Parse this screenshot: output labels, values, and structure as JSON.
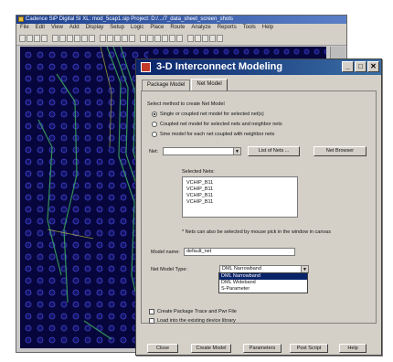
{
  "app_window": {
    "title": "Cadence SiP Digital SI XL: mod_5cap1.sip  Project: D:/.../7_data_sheet_screen_shots",
    "menu": [
      "File",
      "Edit",
      "View",
      "Add",
      "Display",
      "Setup",
      "Logic",
      "Place",
      "Route",
      "Analyze",
      "Reports",
      "Tools",
      "Help"
    ]
  },
  "dialog": {
    "title": "3-D Interconnect Modeling",
    "tabs": [
      "Package Model",
      "Net Model"
    ],
    "active_tab": "Net Model",
    "instructions": "Select method to create Net Model",
    "options": [
      {
        "label": "Single or coupled net model for selected net(s)",
        "selected": true
      },
      {
        "label": "Coupled net model for selected nets and neighbor nets",
        "selected": false
      },
      {
        "label": "Sme model for each net coupled with neighbor nets",
        "selected": false
      }
    ],
    "net_label": "Net:",
    "net_value": "",
    "list_of_nets_button": "List of Nets ...",
    "net_browser_button": "Net Browser",
    "selected_nets_label": "Selected Nets:",
    "selected_nets": [
      "VCHIP_B11",
      "VCHIP_B11",
      "VCHIP_B11",
      "VCHIP_B11"
    ],
    "note": "* Nets can also be selected by mouse pick in the window in canvas",
    "model_name_label": "Model name:",
    "model_name_value": "default_net",
    "net_model_type_label": "Net Model Type:",
    "net_model_type_value": "DML Narrowband",
    "net_model_type_options": [
      "DML Narrowband",
      "DML Wideband",
      "S-Parameter"
    ],
    "net_model_type_selected_index": 0,
    "checkboxes": [
      {
        "label": "Create Package Trace and Pwr File",
        "checked": false
      },
      {
        "label": "Load into the existing device library",
        "checked": false
      }
    ],
    "buttons": [
      "Close",
      "Create Model",
      "Parameters",
      "Post Script",
      "Help"
    ]
  },
  "colors": {
    "title_bar": "#0a246a",
    "canvas_bg": "#06063c",
    "dialog_bg": "#d4d0c8",
    "selection": "#0a246a"
  }
}
